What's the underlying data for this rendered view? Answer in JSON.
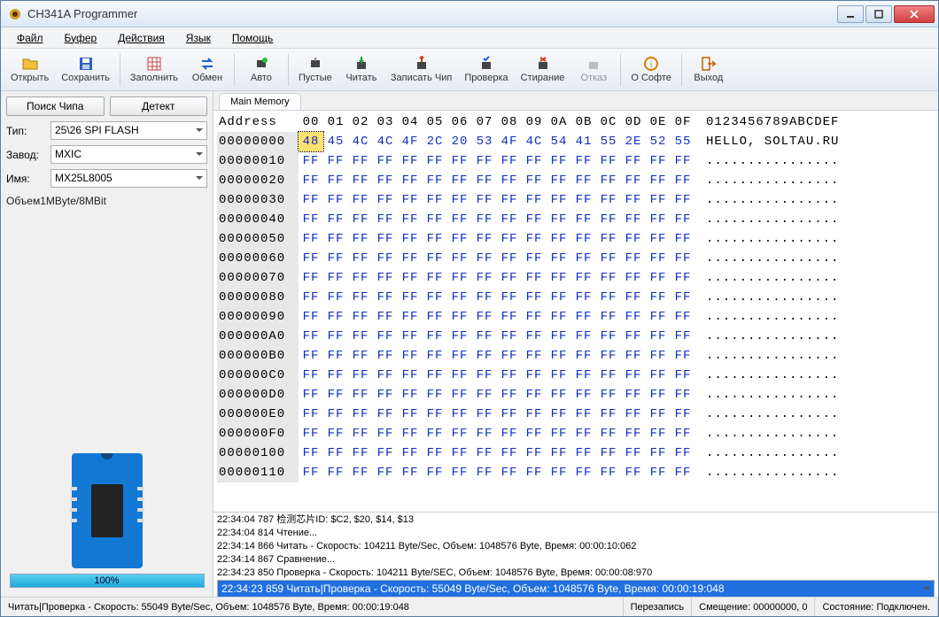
{
  "window": {
    "title": "CH341A Programmer"
  },
  "menu": {
    "file": "Файл",
    "buffer": "Буфер",
    "actions": "Действия",
    "lang": "Язык",
    "help": "Помощь"
  },
  "toolbar": {
    "open": "Открыть",
    "save": "Сохранить",
    "fill": "Заполнить",
    "swap": "Обмен",
    "auto": "Авто",
    "blank": "Пустые",
    "read": "Читать",
    "write": "Записать Чип",
    "verify": "Проверка",
    "erase": "Стирание",
    "cancel": "Отказ",
    "about": "О Софте",
    "exit": "Выход"
  },
  "sidebar": {
    "detect_chip": "Поиск Чипа",
    "detect": "Детект",
    "type_label": "Тип:",
    "type_value": "25\\26 SPI FLASH",
    "vendor_label": "Завод:",
    "vendor_value": "MXIC",
    "name_label": "Имя:",
    "name_value": "MX25L8005",
    "volume": "Объем1MByte/8MBit",
    "progress": "100%"
  },
  "tab": {
    "main": "Main Memory"
  },
  "hex": {
    "header_addr": "Address",
    "cols": [
      "00",
      "01",
      "02",
      "03",
      "04",
      "05",
      "06",
      "07",
      "08",
      "09",
      "0A",
      "0B",
      "0C",
      "0D",
      "0E",
      "0F"
    ],
    "ascii_header": "0123456789ABCDEF",
    "rows": [
      {
        "addr": "00000000",
        "bytes": [
          "48",
          "45",
          "4C",
          "4C",
          "4F",
          "2C",
          "20",
          "53",
          "4F",
          "4C",
          "54",
          "41",
          "55",
          "2E",
          "52",
          "55"
        ],
        "ascii": "HELLO, SOLTAU.RU"
      },
      {
        "addr": "00000010",
        "bytes": [
          "FF",
          "FF",
          "FF",
          "FF",
          "FF",
          "FF",
          "FF",
          "FF",
          "FF",
          "FF",
          "FF",
          "FF",
          "FF",
          "FF",
          "FF",
          "FF"
        ],
        "ascii": "................"
      },
      {
        "addr": "00000020",
        "bytes": [
          "FF",
          "FF",
          "FF",
          "FF",
          "FF",
          "FF",
          "FF",
          "FF",
          "FF",
          "FF",
          "FF",
          "FF",
          "FF",
          "FF",
          "FF",
          "FF"
        ],
        "ascii": "................"
      },
      {
        "addr": "00000030",
        "bytes": [
          "FF",
          "FF",
          "FF",
          "FF",
          "FF",
          "FF",
          "FF",
          "FF",
          "FF",
          "FF",
          "FF",
          "FF",
          "FF",
          "FF",
          "FF",
          "FF"
        ],
        "ascii": "................"
      },
      {
        "addr": "00000040",
        "bytes": [
          "FF",
          "FF",
          "FF",
          "FF",
          "FF",
          "FF",
          "FF",
          "FF",
          "FF",
          "FF",
          "FF",
          "FF",
          "FF",
          "FF",
          "FF",
          "FF"
        ],
        "ascii": "................"
      },
      {
        "addr": "00000050",
        "bytes": [
          "FF",
          "FF",
          "FF",
          "FF",
          "FF",
          "FF",
          "FF",
          "FF",
          "FF",
          "FF",
          "FF",
          "FF",
          "FF",
          "FF",
          "FF",
          "FF"
        ],
        "ascii": "................"
      },
      {
        "addr": "00000060",
        "bytes": [
          "FF",
          "FF",
          "FF",
          "FF",
          "FF",
          "FF",
          "FF",
          "FF",
          "FF",
          "FF",
          "FF",
          "FF",
          "FF",
          "FF",
          "FF",
          "FF"
        ],
        "ascii": "................"
      },
      {
        "addr": "00000070",
        "bytes": [
          "FF",
          "FF",
          "FF",
          "FF",
          "FF",
          "FF",
          "FF",
          "FF",
          "FF",
          "FF",
          "FF",
          "FF",
          "FF",
          "FF",
          "FF",
          "FF"
        ],
        "ascii": "................"
      },
      {
        "addr": "00000080",
        "bytes": [
          "FF",
          "FF",
          "FF",
          "FF",
          "FF",
          "FF",
          "FF",
          "FF",
          "FF",
          "FF",
          "FF",
          "FF",
          "FF",
          "FF",
          "FF",
          "FF"
        ],
        "ascii": "................"
      },
      {
        "addr": "00000090",
        "bytes": [
          "FF",
          "FF",
          "FF",
          "FF",
          "FF",
          "FF",
          "FF",
          "FF",
          "FF",
          "FF",
          "FF",
          "FF",
          "FF",
          "FF",
          "FF",
          "FF"
        ],
        "ascii": "................"
      },
      {
        "addr": "000000A0",
        "bytes": [
          "FF",
          "FF",
          "FF",
          "FF",
          "FF",
          "FF",
          "FF",
          "FF",
          "FF",
          "FF",
          "FF",
          "FF",
          "FF",
          "FF",
          "FF",
          "FF"
        ],
        "ascii": "................"
      },
      {
        "addr": "000000B0",
        "bytes": [
          "FF",
          "FF",
          "FF",
          "FF",
          "FF",
          "FF",
          "FF",
          "FF",
          "FF",
          "FF",
          "FF",
          "FF",
          "FF",
          "FF",
          "FF",
          "FF"
        ],
        "ascii": "................"
      },
      {
        "addr": "000000C0",
        "bytes": [
          "FF",
          "FF",
          "FF",
          "FF",
          "FF",
          "FF",
          "FF",
          "FF",
          "FF",
          "FF",
          "FF",
          "FF",
          "FF",
          "FF",
          "FF",
          "FF"
        ],
        "ascii": "................"
      },
      {
        "addr": "000000D0",
        "bytes": [
          "FF",
          "FF",
          "FF",
          "FF",
          "FF",
          "FF",
          "FF",
          "FF",
          "FF",
          "FF",
          "FF",
          "FF",
          "FF",
          "FF",
          "FF",
          "FF"
        ],
        "ascii": "................"
      },
      {
        "addr": "000000E0",
        "bytes": [
          "FF",
          "FF",
          "FF",
          "FF",
          "FF",
          "FF",
          "FF",
          "FF",
          "FF",
          "FF",
          "FF",
          "FF",
          "FF",
          "FF",
          "FF",
          "FF"
        ],
        "ascii": "................"
      },
      {
        "addr": "000000F0",
        "bytes": [
          "FF",
          "FF",
          "FF",
          "FF",
          "FF",
          "FF",
          "FF",
          "FF",
          "FF",
          "FF",
          "FF",
          "FF",
          "FF",
          "FF",
          "FF",
          "FF"
        ],
        "ascii": "................"
      },
      {
        "addr": "00000100",
        "bytes": [
          "FF",
          "FF",
          "FF",
          "FF",
          "FF",
          "FF",
          "FF",
          "FF",
          "FF",
          "FF",
          "FF",
          "FF",
          "FF",
          "FF",
          "FF",
          "FF"
        ],
        "ascii": "................"
      },
      {
        "addr": "00000110",
        "bytes": [
          "FF",
          "FF",
          "FF",
          "FF",
          "FF",
          "FF",
          "FF",
          "FF",
          "FF",
          "FF",
          "FF",
          "FF",
          "FF",
          "FF",
          "FF",
          "FF"
        ],
        "ascii": "................"
      }
    ]
  },
  "log": [
    "22:34:04 787 检测芯片ID: $C2, $20, $14, $13",
    "22:34:04 814 Чтение...",
    "22:34:14 866 Читать - Скорость: 104211 Byte/Sec, Объем: 1048576 Byte, Время: 00:00:10:062",
    "22:34:14 867 Сравнение...",
    "22:34:23 850 Проверка - Скорость: 104211 Byte/SEC, Объем: 1048576 Byte, Время: 00:00:08:970",
    "22:34:23 859 Читать|Проверка - Скорость: 55049 Byte/Sec, Объем: 1048576 Byte, Время: 00:00:19:048"
  ],
  "status": {
    "main": "Читать|Проверка - Скорость: 55049 Byte/Sec, Объем: 1048576 Byte, Время: 00:00:19:048",
    "overwrite": "Перезапись",
    "offset": "Смещение: 00000000, 0",
    "state": "Состояние: Подключен."
  }
}
